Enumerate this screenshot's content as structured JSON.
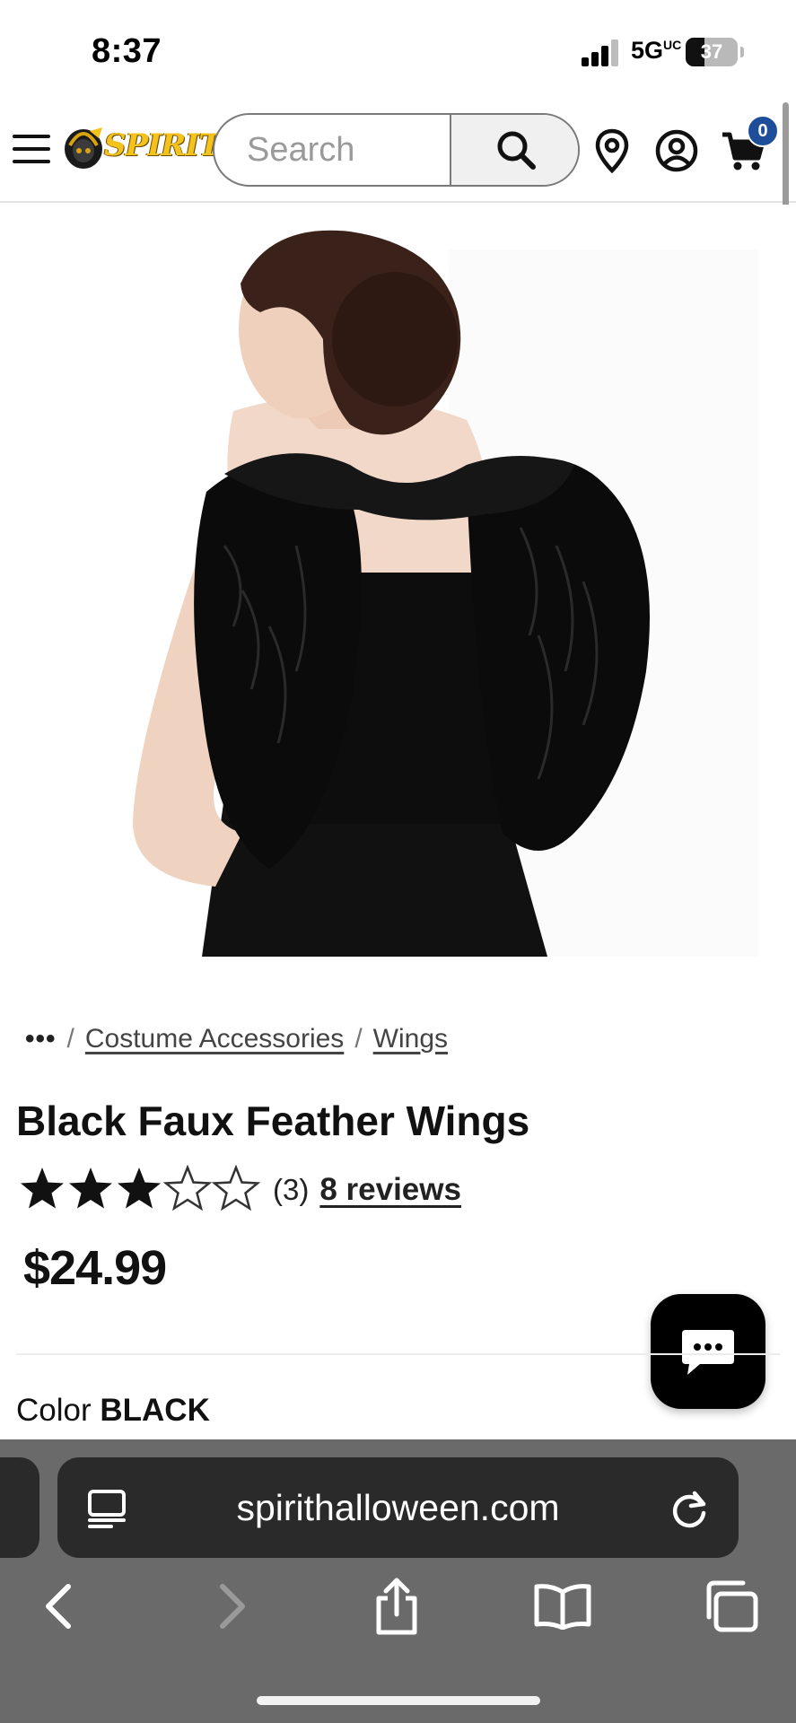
{
  "status_bar": {
    "time": "8:37",
    "network": "5G",
    "network_suffix": "UC",
    "battery": "37"
  },
  "header": {
    "logo_text": "SPIRIT",
    "search_placeholder": "Search",
    "cart_count": "0"
  },
  "product_image": {
    "description_icon": "black-feather-wings-photo"
  },
  "breadcrumb": {
    "more": "•••",
    "items": [
      "Costume Accessories",
      "Wings"
    ]
  },
  "product": {
    "title": "Black Faux Feather Wings",
    "rating": 3,
    "rating_max": 5,
    "rating_count": "(3)",
    "reviews_link": "8 reviews",
    "price": "$24.99",
    "color_label": "Color",
    "color_value": "BLACK"
  },
  "browser": {
    "url": "spirithalloween.com"
  },
  "colors": {
    "cart_badge": "#1e4e99",
    "logo_gold": "#f3c21b",
    "browser_bar": "#6a6a6a"
  }
}
